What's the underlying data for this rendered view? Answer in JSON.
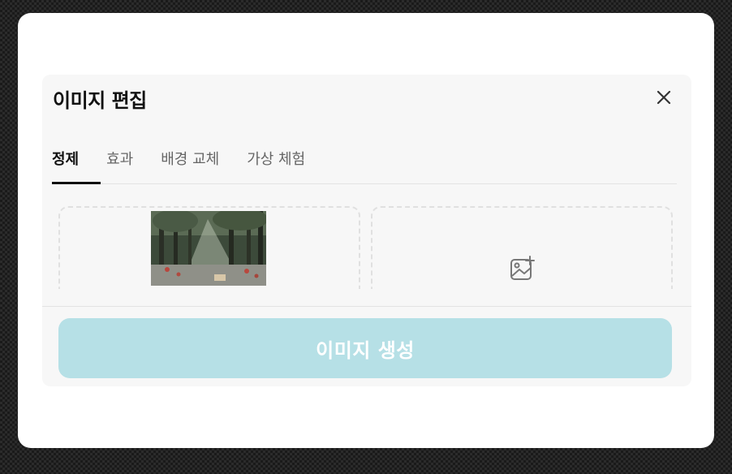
{
  "modal": {
    "title": "이미지 편집",
    "close_icon": "close-icon"
  },
  "tabs": [
    {
      "label": "정제",
      "active": true
    },
    {
      "label": "효과",
      "active": false
    },
    {
      "label": "배경 교체",
      "active": false
    },
    {
      "label": "가상 체험",
      "active": false
    }
  ],
  "source_panel": {
    "image": "forest-photo"
  },
  "result_panel": {
    "icon": "image-add-icon"
  },
  "generate_button": {
    "label": "이미지 생성",
    "background": "#b6e0e6"
  }
}
